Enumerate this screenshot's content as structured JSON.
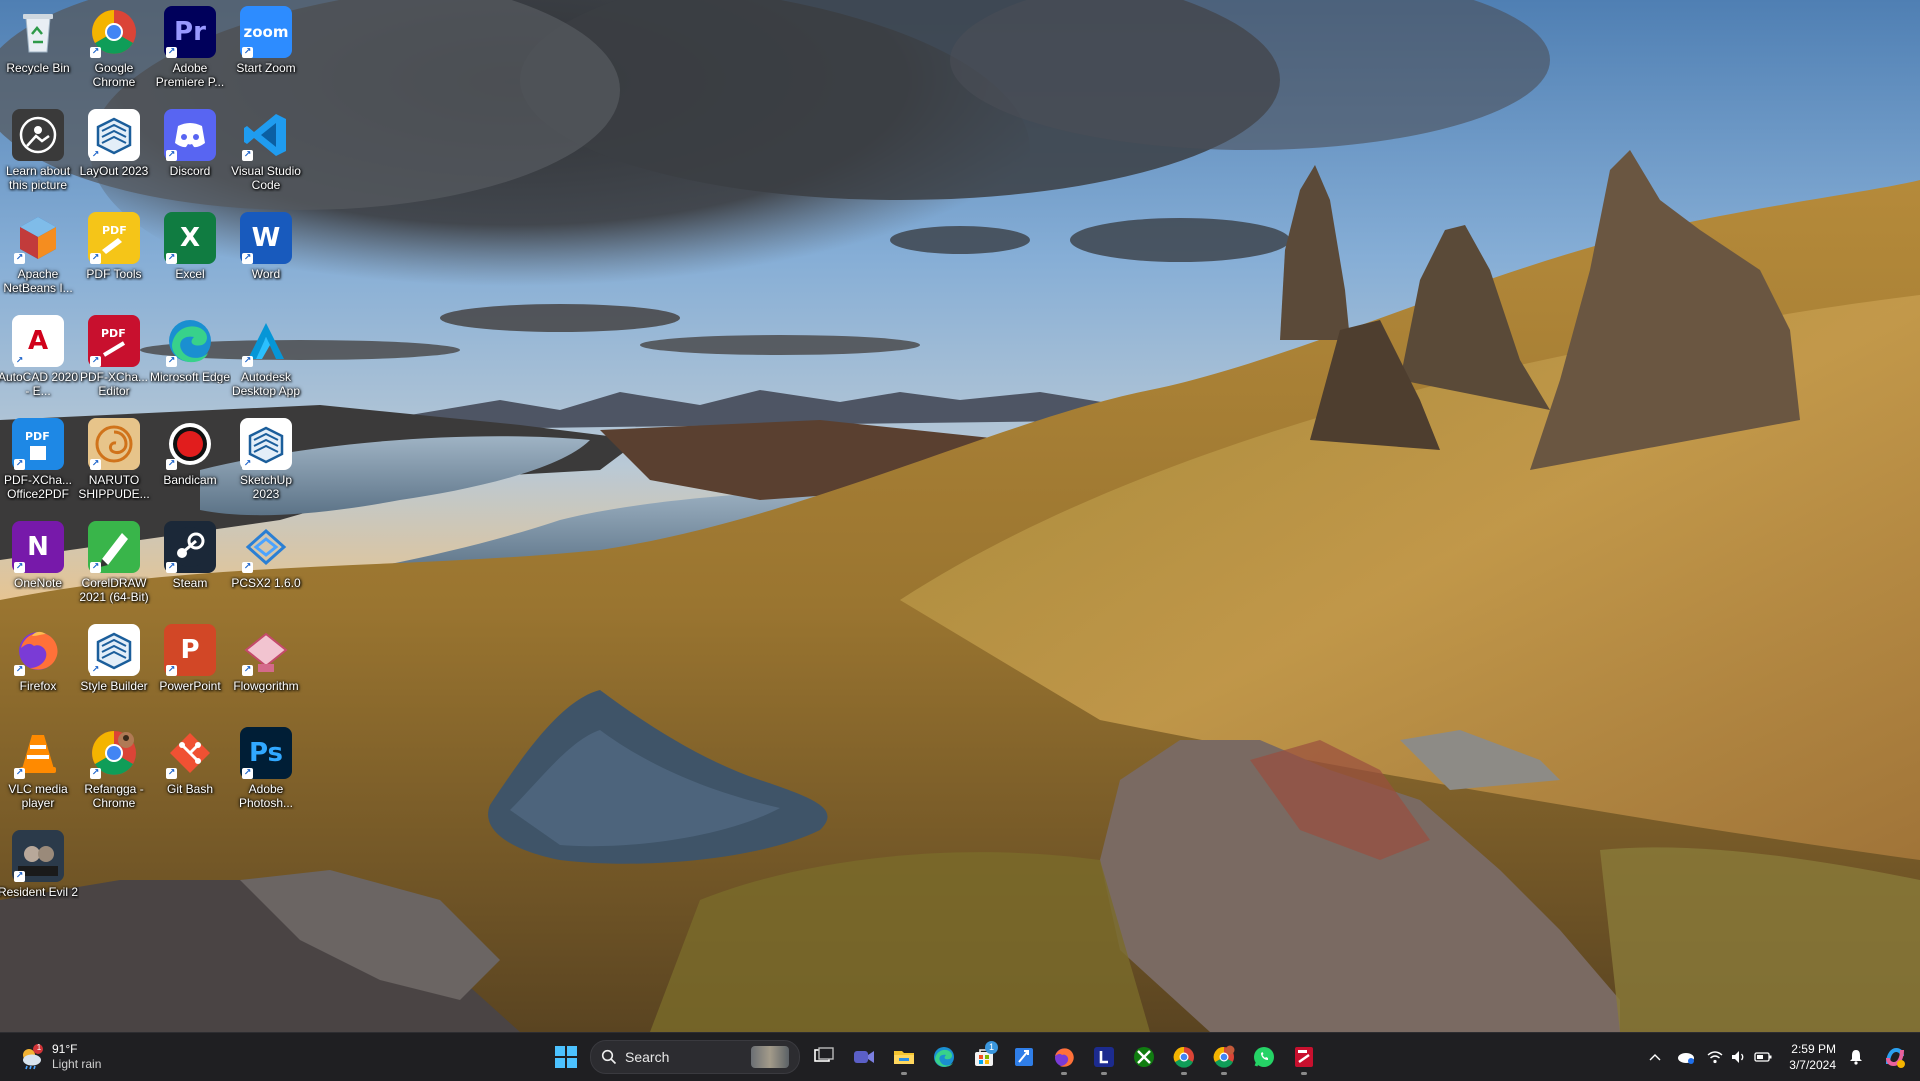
{
  "desktop": {
    "icons": [
      {
        "label": "Recycle Bin",
        "icon": "recycle-bin-icon",
        "bg": "transparent"
      },
      {
        "label": "Google Chrome",
        "icon": "chrome-icon",
        "bg": "transparent"
      },
      {
        "label": "Adobe Premiere P...",
        "icon": "premiere-icon",
        "bg": "#00005b",
        "glyph": "Pr",
        "fg": "#9999ff"
      },
      {
        "label": "Start Zoom",
        "icon": "zoom-icon",
        "bg": "#2d8cff",
        "glyph": "zoom",
        "fg": "#ffffff"
      },
      {
        "label": "Learn about this picture",
        "icon": "learn-picture-icon",
        "bg": "#3a3a3a"
      },
      {
        "label": "LayOut 2023",
        "icon": "layout-icon",
        "bg": "#ffffff"
      },
      {
        "label": "Discord",
        "icon": "discord-icon",
        "bg": "#5865f2"
      },
      {
        "label": "Visual Studio Code",
        "icon": "vscode-icon",
        "bg": "transparent"
      },
      {
        "label": "Apache NetBeans I...",
        "icon": "netbeans-icon",
        "bg": "transparent"
      },
      {
        "label": "PDF Tools",
        "icon": "pdf-tools-icon",
        "bg": "#f5c518",
        "glyph": "PDF",
        "fg": "#ffffff"
      },
      {
        "label": "Excel",
        "icon": "excel-icon",
        "bg": "#107c41",
        "glyph": "X",
        "fg": "#ffffff"
      },
      {
        "label": "Word",
        "icon": "word-icon",
        "bg": "#185abd",
        "glyph": "W",
        "fg": "#ffffff"
      },
      {
        "label": "AutoCAD 2020 - E...",
        "icon": "autocad-icon",
        "bg": "#ffffff",
        "glyph": "A",
        "fg": "#d0021b"
      },
      {
        "label": "PDF-XCha... Editor",
        "icon": "pdf-xchange-editor-icon",
        "bg": "#c8102e",
        "glyph": "PDF",
        "fg": "#ffffff"
      },
      {
        "label": "Microsoft Edge",
        "icon": "edge-icon",
        "bg": "transparent"
      },
      {
        "label": "Autodesk Desktop App",
        "icon": "autodesk-icon",
        "bg": "transparent",
        "glyph": "A",
        "fg": "#0696d7"
      },
      {
        "label": "PDF-XCha... Office2PDF",
        "icon": "pdf-xchange-office2pdf-icon",
        "bg": "#1e88e5",
        "glyph": "PDF",
        "fg": "#ffffff"
      },
      {
        "label": "NARUTO SHIPPUDE...",
        "icon": "naruto-icon",
        "bg": "#e7c48a"
      },
      {
        "label": "Bandicam",
        "icon": "bandicam-icon",
        "bg": "transparent"
      },
      {
        "label": "SketchUp 2023",
        "icon": "sketchup-icon",
        "bg": "#ffffff"
      },
      {
        "label": "OneNote",
        "icon": "onenote-icon",
        "bg": "#7719aa",
        "glyph": "N",
        "fg": "#ffffff"
      },
      {
        "label": "CorelDRAW 2021 (64-Bit)",
        "icon": "coreldraw-icon",
        "bg": "#39b54a"
      },
      {
        "label": "Steam",
        "icon": "steam-icon",
        "bg": "#1b2838"
      },
      {
        "label": "PCSX2 1.6.0",
        "icon": "pcsx2-icon",
        "bg": "transparent"
      },
      {
        "label": "Firefox",
        "icon": "firefox-icon",
        "bg": "transparent"
      },
      {
        "label": "Style Builder",
        "icon": "style-builder-icon",
        "bg": "#ffffff"
      },
      {
        "label": "PowerPoint",
        "icon": "powerpoint-icon",
        "bg": "#d24726",
        "glyph": "P",
        "fg": "#ffffff"
      },
      {
        "label": "Flowgorithm",
        "icon": "flowgorithm-icon",
        "bg": "transparent"
      },
      {
        "label": "VLC media player",
        "icon": "vlc-icon",
        "bg": "transparent"
      },
      {
        "label": "Refangga - Chrome",
        "icon": "chrome-profile-icon",
        "bg": "transparent"
      },
      {
        "label": "Git Bash",
        "icon": "git-bash-icon",
        "bg": "transparent"
      },
      {
        "label": "Adobe Photosh...",
        "icon": "photoshop-icon",
        "bg": "#001e36",
        "glyph": "Ps",
        "fg": "#31a8ff"
      },
      {
        "label": "Resident Evil 2",
        "icon": "resident-evil-icon",
        "bg": "#2b3a4a"
      }
    ]
  },
  "taskbar": {
    "weather": {
      "temp": "91°F",
      "cond": "Light rain",
      "badge": "1"
    },
    "search_label": "Search",
    "apps": [
      {
        "name": "task-view-icon",
        "running": false
      },
      {
        "name": "meet-icon",
        "running": false
      },
      {
        "name": "file-explorer-icon",
        "running": true
      },
      {
        "name": "edge-icon",
        "running": false
      },
      {
        "name": "microsoft-store-icon",
        "running": false,
        "badge": "1"
      },
      {
        "name": "app-shortcut-icon",
        "running": false
      },
      {
        "name": "firefox-icon",
        "running": true
      },
      {
        "name": "l-app-icon",
        "running": true
      },
      {
        "name": "xbox-icon",
        "running": false
      },
      {
        "name": "chrome-icon",
        "running": true
      },
      {
        "name": "chrome-profile-icon",
        "running": true
      },
      {
        "name": "whatsapp-icon",
        "running": false
      },
      {
        "name": "pdf-xchange-icon",
        "running": true
      }
    ],
    "clock": {
      "time": "2:59 PM",
      "date": "3/7/2024"
    }
  },
  "colors": {
    "accent": "#0078d4",
    "taskbar": "#1f1f22"
  }
}
